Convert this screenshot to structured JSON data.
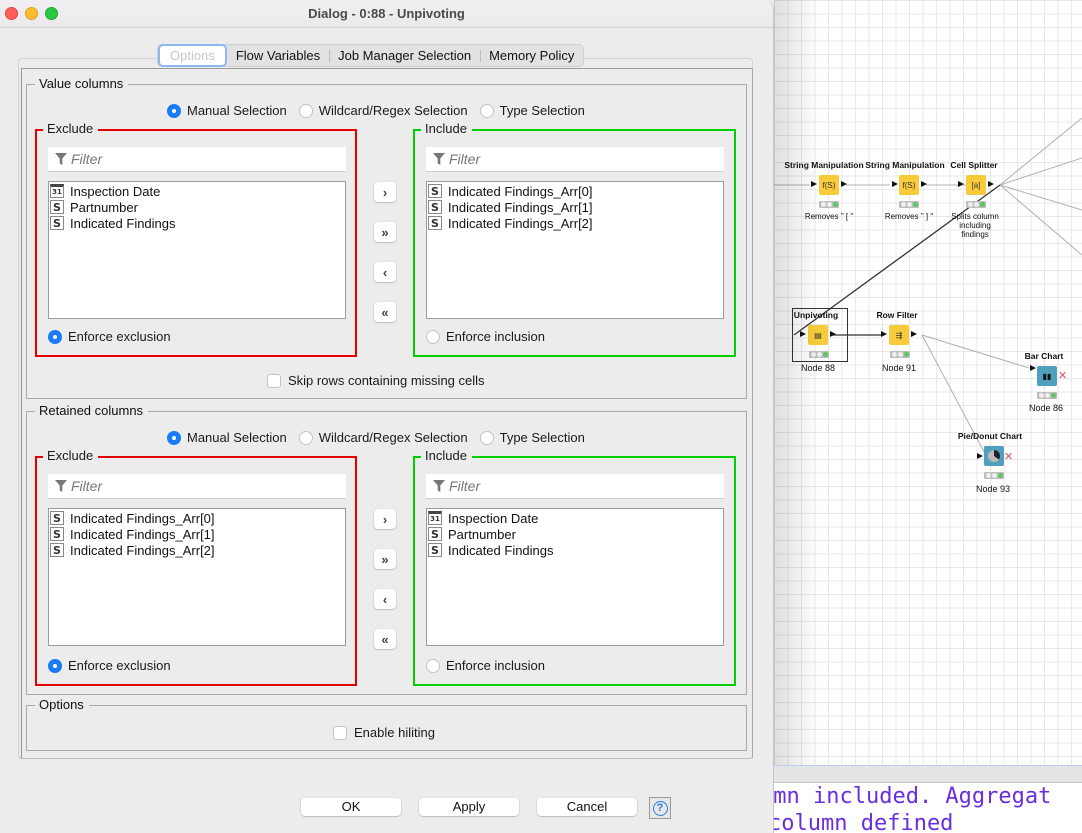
{
  "window": {
    "title": "Dialog - 0:88 - Unpivoting"
  },
  "tabs": [
    {
      "label": "Options",
      "active": true
    },
    {
      "label": "Flow Variables",
      "active": false
    },
    {
      "label": "Job Manager Selection",
      "active": false
    },
    {
      "label": "Memory Policy",
      "active": false
    }
  ],
  "value_columns": {
    "title": "Value columns",
    "modes": [
      "Manual Selection",
      "Wildcard/Regex Selection",
      "Type Selection"
    ],
    "selected_mode": "Manual Selection",
    "exclude": {
      "title": "Exclude",
      "filter_placeholder": "Filter",
      "items": [
        {
          "type": "date",
          "type_icon": "31",
          "name": "Inspection Date"
        },
        {
          "type": "string",
          "type_icon": "S",
          "name": "Partnumber"
        },
        {
          "type": "string",
          "type_icon": "S",
          "name": "Indicated Findings"
        }
      ],
      "enforce_label": "Enforce exclusion",
      "enforce_checked": true
    },
    "include": {
      "title": "Include",
      "filter_placeholder": "Filter",
      "items": [
        {
          "type": "string",
          "type_icon": "S",
          "name": "Indicated Findings_Arr[0]"
        },
        {
          "type": "string",
          "type_icon": "S",
          "name": "Indicated Findings_Arr[1]"
        },
        {
          "type": "string",
          "type_icon": "S",
          "name": "Indicated Findings_Arr[2]"
        }
      ],
      "enforce_label": "Enforce inclusion",
      "enforce_checked": false
    },
    "skip_missing_label": "Skip rows containing missing cells",
    "skip_missing_checked": false
  },
  "retained_columns": {
    "title": "Retained columns",
    "modes": [
      "Manual Selection",
      "Wildcard/Regex Selection",
      "Type Selection"
    ],
    "selected_mode": "Manual Selection",
    "exclude": {
      "title": "Exclude",
      "filter_placeholder": "Filter",
      "items": [
        {
          "type": "string",
          "type_icon": "S",
          "name": "Indicated Findings_Arr[0]"
        },
        {
          "type": "string",
          "type_icon": "S",
          "name": "Indicated Findings_Arr[1]"
        },
        {
          "type": "string",
          "type_icon": "S",
          "name": "Indicated Findings_Arr[2]"
        }
      ],
      "enforce_label": "Enforce exclusion",
      "enforce_checked": true
    },
    "include": {
      "title": "Include",
      "filter_placeholder": "Filter",
      "items": [
        {
          "type": "date",
          "type_icon": "31",
          "name": "Inspection Date"
        },
        {
          "type": "string",
          "type_icon": "S",
          "name": "Partnumber"
        },
        {
          "type": "string",
          "type_icon": "S",
          "name": "Indicated Findings"
        }
      ],
      "enforce_label": "Enforce inclusion",
      "enforce_checked": false
    }
  },
  "transfer_buttons": {
    "add": "›",
    "add_all": "»",
    "remove": "‹",
    "remove_all": "«"
  },
  "options": {
    "title": "Options",
    "hiliting_label": "Enable hiliting",
    "hiliting_checked": false
  },
  "footer": {
    "ok": "OK",
    "apply": "Apply",
    "cancel": "Cancel",
    "help_icon": "?"
  },
  "workflow": {
    "nodes": [
      {
        "id": "string-manip-1",
        "title": "String Manipulation",
        "label": "Removes \" [ \"",
        "color": "yellow",
        "glyph": "f(S)"
      },
      {
        "id": "string-manip-2",
        "title": "String Manipulation",
        "label": "Removes \" ] \"",
        "color": "yellow",
        "glyph": "f(S)"
      },
      {
        "id": "cell-splitter",
        "title": "Cell Splitter",
        "label": "Splits column including findings",
        "color": "yellow",
        "glyph": "[a]"
      },
      {
        "id": "unpivoting",
        "title": "Unpivoting",
        "label": "Node 88",
        "color": "yellow",
        "glyph": "unpivot",
        "selected": true
      },
      {
        "id": "row-filter",
        "title": "Row Filter",
        "label": "Node 91",
        "color": "yellow",
        "glyph": "filter"
      },
      {
        "id": "bar-chart",
        "title": "Bar Chart",
        "label": "Node 86",
        "color": "blue",
        "glyph": "bar"
      },
      {
        "id": "pie-chart",
        "title": "Pie/Donut Chart",
        "label": "Node 93",
        "color": "blue",
        "glyph": "pie"
      }
    ],
    "node_colors": {
      "yellow": "#f7cb3a",
      "blue": "#4f9fbd",
      "status_green": "#5fc35f"
    }
  },
  "console": {
    "lines": [
      "umn included. Aggregat",
      "column defined"
    ],
    "color": "#6a2ee0"
  }
}
